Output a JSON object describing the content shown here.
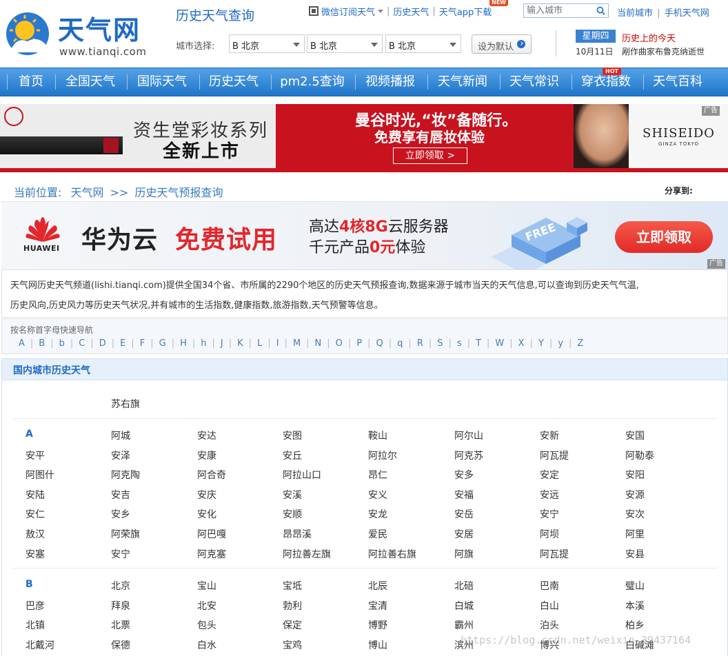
{
  "header": {
    "logo_text": "天气网",
    "logo_url": "www.tianqi.com",
    "page_heading": "历史天气查询",
    "top_links": [
      "微信订阅天气",
      "历史天气",
      "天气app下载"
    ],
    "new_badge": "NEW",
    "search_placeholder": "输入城市",
    "right_links": [
      "当前城市",
      "手机天气网"
    ],
    "city_select_label": "城市选择:",
    "selects": [
      "B 北京",
      "B 北京",
      "B 北京"
    ],
    "set_default_label": "设为默认",
    "weekday": "星期四",
    "today_heading": "历史上的今天",
    "today_date": "10月11日",
    "today_event": "剐作曲家布鲁克纳逝世"
  },
  "nav": {
    "items": [
      "首页",
      "全国天气",
      "国际天气",
      "历史天气",
      "pm2.5查询",
      "视频播报",
      "天气新闻",
      "天气常识",
      "穿衣指数",
      "天气百科"
    ],
    "hot_badge": "HOT"
  },
  "ad1": {
    "title1": "资生堂彩妆系列",
    "title2": "全新上市",
    "slogan1": "曼谷时光,“妆”备随行。",
    "slogan2": "免费享有唇妆体验",
    "button": "立即领取 >",
    "brand": "SHISEIDO",
    "brand_sub": "GINZA TOKYO",
    "ad_tag": "广告"
  },
  "breadcrumb": {
    "label": "当前位置:",
    "home": "天气网",
    "sep": ">>",
    "current": "历史天气预报查询"
  },
  "share_label": "分享到:",
  "ad2": {
    "brand": "HUAWEI",
    "t1": "华为云",
    "t2": "免费试用",
    "line1_pre": "高达",
    "line1_red": "4核8G",
    "line1_post": "云服务器",
    "line2_pre": "千元产品",
    "line2_red": "0元",
    "line2_post": "体验",
    "button": "立即领取",
    "ad_tag": "广告",
    "iso_text": "FREE"
  },
  "intro": {
    "line1": "天气网历史天气频道(lishi.tianqi.com)提供全国34个省、市所属的2290个地区的历史天气预报查询,数据来源于城市当天的天气信息,可以查询到历史天气气温,",
    "line2": "历史风向,历史风力等历史天气状况,并有城市的生活指数,健康指数,旅游指数,天气预警等信息。"
  },
  "alpha": {
    "title": "按名称首字母快速导航",
    "letters": [
      "A",
      "B",
      "b",
      "C",
      "D",
      "E",
      "F",
      "G",
      "H",
      "h",
      "J",
      "K",
      "L",
      "I",
      "M",
      "N",
      "O",
      "P",
      "Q",
      "q",
      "R",
      "S",
      "s",
      "T",
      "W",
      "X",
      "Y",
      "y",
      "Z"
    ]
  },
  "section": {
    "title": "国内城市历史天气",
    "top_city": "苏右旗",
    "groups": [
      {
        "letter": "A",
        "rows": [
          [
            "",
            "阿城",
            "安达",
            "安图",
            "鞍山",
            "阿尔山",
            "安新",
            "安国"
          ],
          [
            "安平",
            "安泽",
            "安康",
            "安丘",
            "阿拉尔",
            "阿克苏",
            "阿瓦提",
            "阿勒泰"
          ],
          [
            "阿图什",
            "阿克陶",
            "阿合奇",
            "阿拉山口",
            "昂仁",
            "安多",
            "安定",
            "安阳"
          ],
          [
            "安陆",
            "安吉",
            "安庆",
            "安溪",
            "安义",
            "安福",
            "安远",
            "安源"
          ],
          [
            "安仁",
            "安乡",
            "安化",
            "安顺",
            "安龙",
            "安岳",
            "安宁",
            "安次"
          ],
          [
            "敖汉",
            "阿荣旗",
            "阿巴嘎",
            "昂昂溪",
            "爱民",
            "安居",
            "阿坝",
            "阿里"
          ],
          [
            "安塞",
            "安宁",
            "阿克塞",
            "阿拉善左旗",
            "阿拉善右旗",
            "阿旗",
            "阿瓦提",
            "安县"
          ]
        ]
      },
      {
        "letter": "B",
        "rows": [
          [
            "",
            "北京",
            "宝山",
            "宝坻",
            "北辰",
            "北碚",
            "巴南",
            "璧山"
          ],
          [
            "巴彦",
            "拜泉",
            "北安",
            "勃利",
            "宝清",
            "白城",
            "白山",
            "本溪"
          ],
          [
            "北镇",
            "北票",
            "包头",
            "保定",
            "博野",
            "霸州",
            "泊头",
            "柏乡"
          ],
          [
            "北戴河",
            "保德",
            "白水",
            "宝鸡",
            "博山",
            "滨州",
            "博兴",
            "白碱滩"
          ]
        ]
      }
    ]
  },
  "watermark": "https://blog.csdn.net/weixin_39437164",
  "colors": {
    "brand_blue": "#1e6ac6",
    "nav_top": "#56a2e8",
    "nav_bottom": "#1f75c8",
    "hot_red": "#e2231a",
    "ad_red": "#c8121e"
  }
}
